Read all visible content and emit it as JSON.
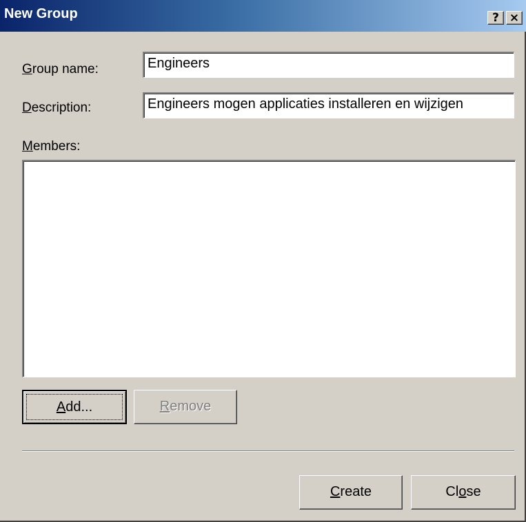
{
  "window": {
    "title": "New Group",
    "help_symbol": "?",
    "close_symbol": "×"
  },
  "form": {
    "group_name_label": {
      "before": "",
      "mnemonic": "G",
      "after": "roup name:"
    },
    "group_name_value": "Engineers",
    "description_label": {
      "before": "",
      "mnemonic": "D",
      "after": "escription:"
    },
    "description_value": "Engineers mogen applicaties installeren en wijzigen",
    "members_label": {
      "before": "",
      "mnemonic": "M",
      "after": "embers:"
    },
    "members": []
  },
  "buttons": {
    "add": {
      "before": "",
      "mnemonic": "A",
      "after": "dd..."
    },
    "remove": {
      "before": "",
      "mnemonic": "R",
      "after": "emove"
    },
    "create": {
      "before": "",
      "mnemonic": "C",
      "after": "reate"
    },
    "close": {
      "before": "Cl",
      "mnemonic": "o",
      "after": "se"
    }
  },
  "icons": {
    "help": "help-icon",
    "close": "close-icon"
  }
}
